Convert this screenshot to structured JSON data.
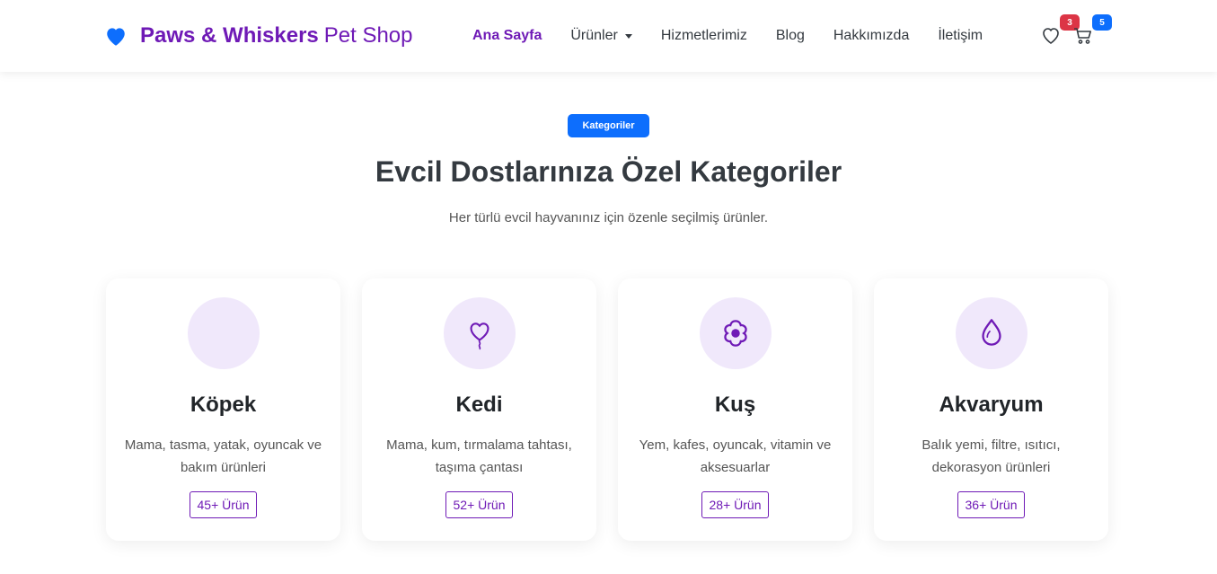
{
  "brand": {
    "name_bold": "Paws & Whiskers",
    "name_light": "Pet Shop",
    "icon": "heart-icon",
    "color": "#6f1ab6"
  },
  "nav": {
    "items": [
      {
        "label": "Ana Sayfa"
      },
      {
        "label": "Ürünler"
      },
      {
        "label": "Hizmetlerimiz"
      },
      {
        "label": "Blog"
      },
      {
        "label": "Hakkımızda"
      },
      {
        "label": "İletişim"
      }
    ],
    "wishlist_count": "3",
    "cart_count": "5"
  },
  "section": {
    "badge": "Kategoriler",
    "title": "Evcil Dostlarınıza Özel Kategoriler",
    "subtitle": "Her türlü evcil hayvanınız için özenle seçilmiş ürünler."
  },
  "categories": [
    {
      "title": "Köpek",
      "desc": "Mama, tasma, yatak, oyuncak ve bakım ürünleri",
      "count": "45+ Ürün",
      "icon": ""
    },
    {
      "title": "Kedi",
      "desc": "Mama, kum, tırmalama tahtası, taşıma çantası",
      "count": "52+ Ürün",
      "icon": "heart-balloon-icon"
    },
    {
      "title": "Kuş",
      "desc": "Yem, kafes, oyuncak, vitamin ve aksesuarlar",
      "count": "28+ Ürün",
      "icon": "flower-icon"
    },
    {
      "title": "Akvaryum",
      "desc": "Balık yemi, filtre, ısıtıcı, dekorasyon ürünleri",
      "count": "36+ Ürün",
      "icon": "droplet-icon"
    }
  ],
  "colors": {
    "accent": "#6f1ab6",
    "primary": "#0d6efd",
    "danger": "#dc3545",
    "icon_bg": "#f0e8fb"
  }
}
